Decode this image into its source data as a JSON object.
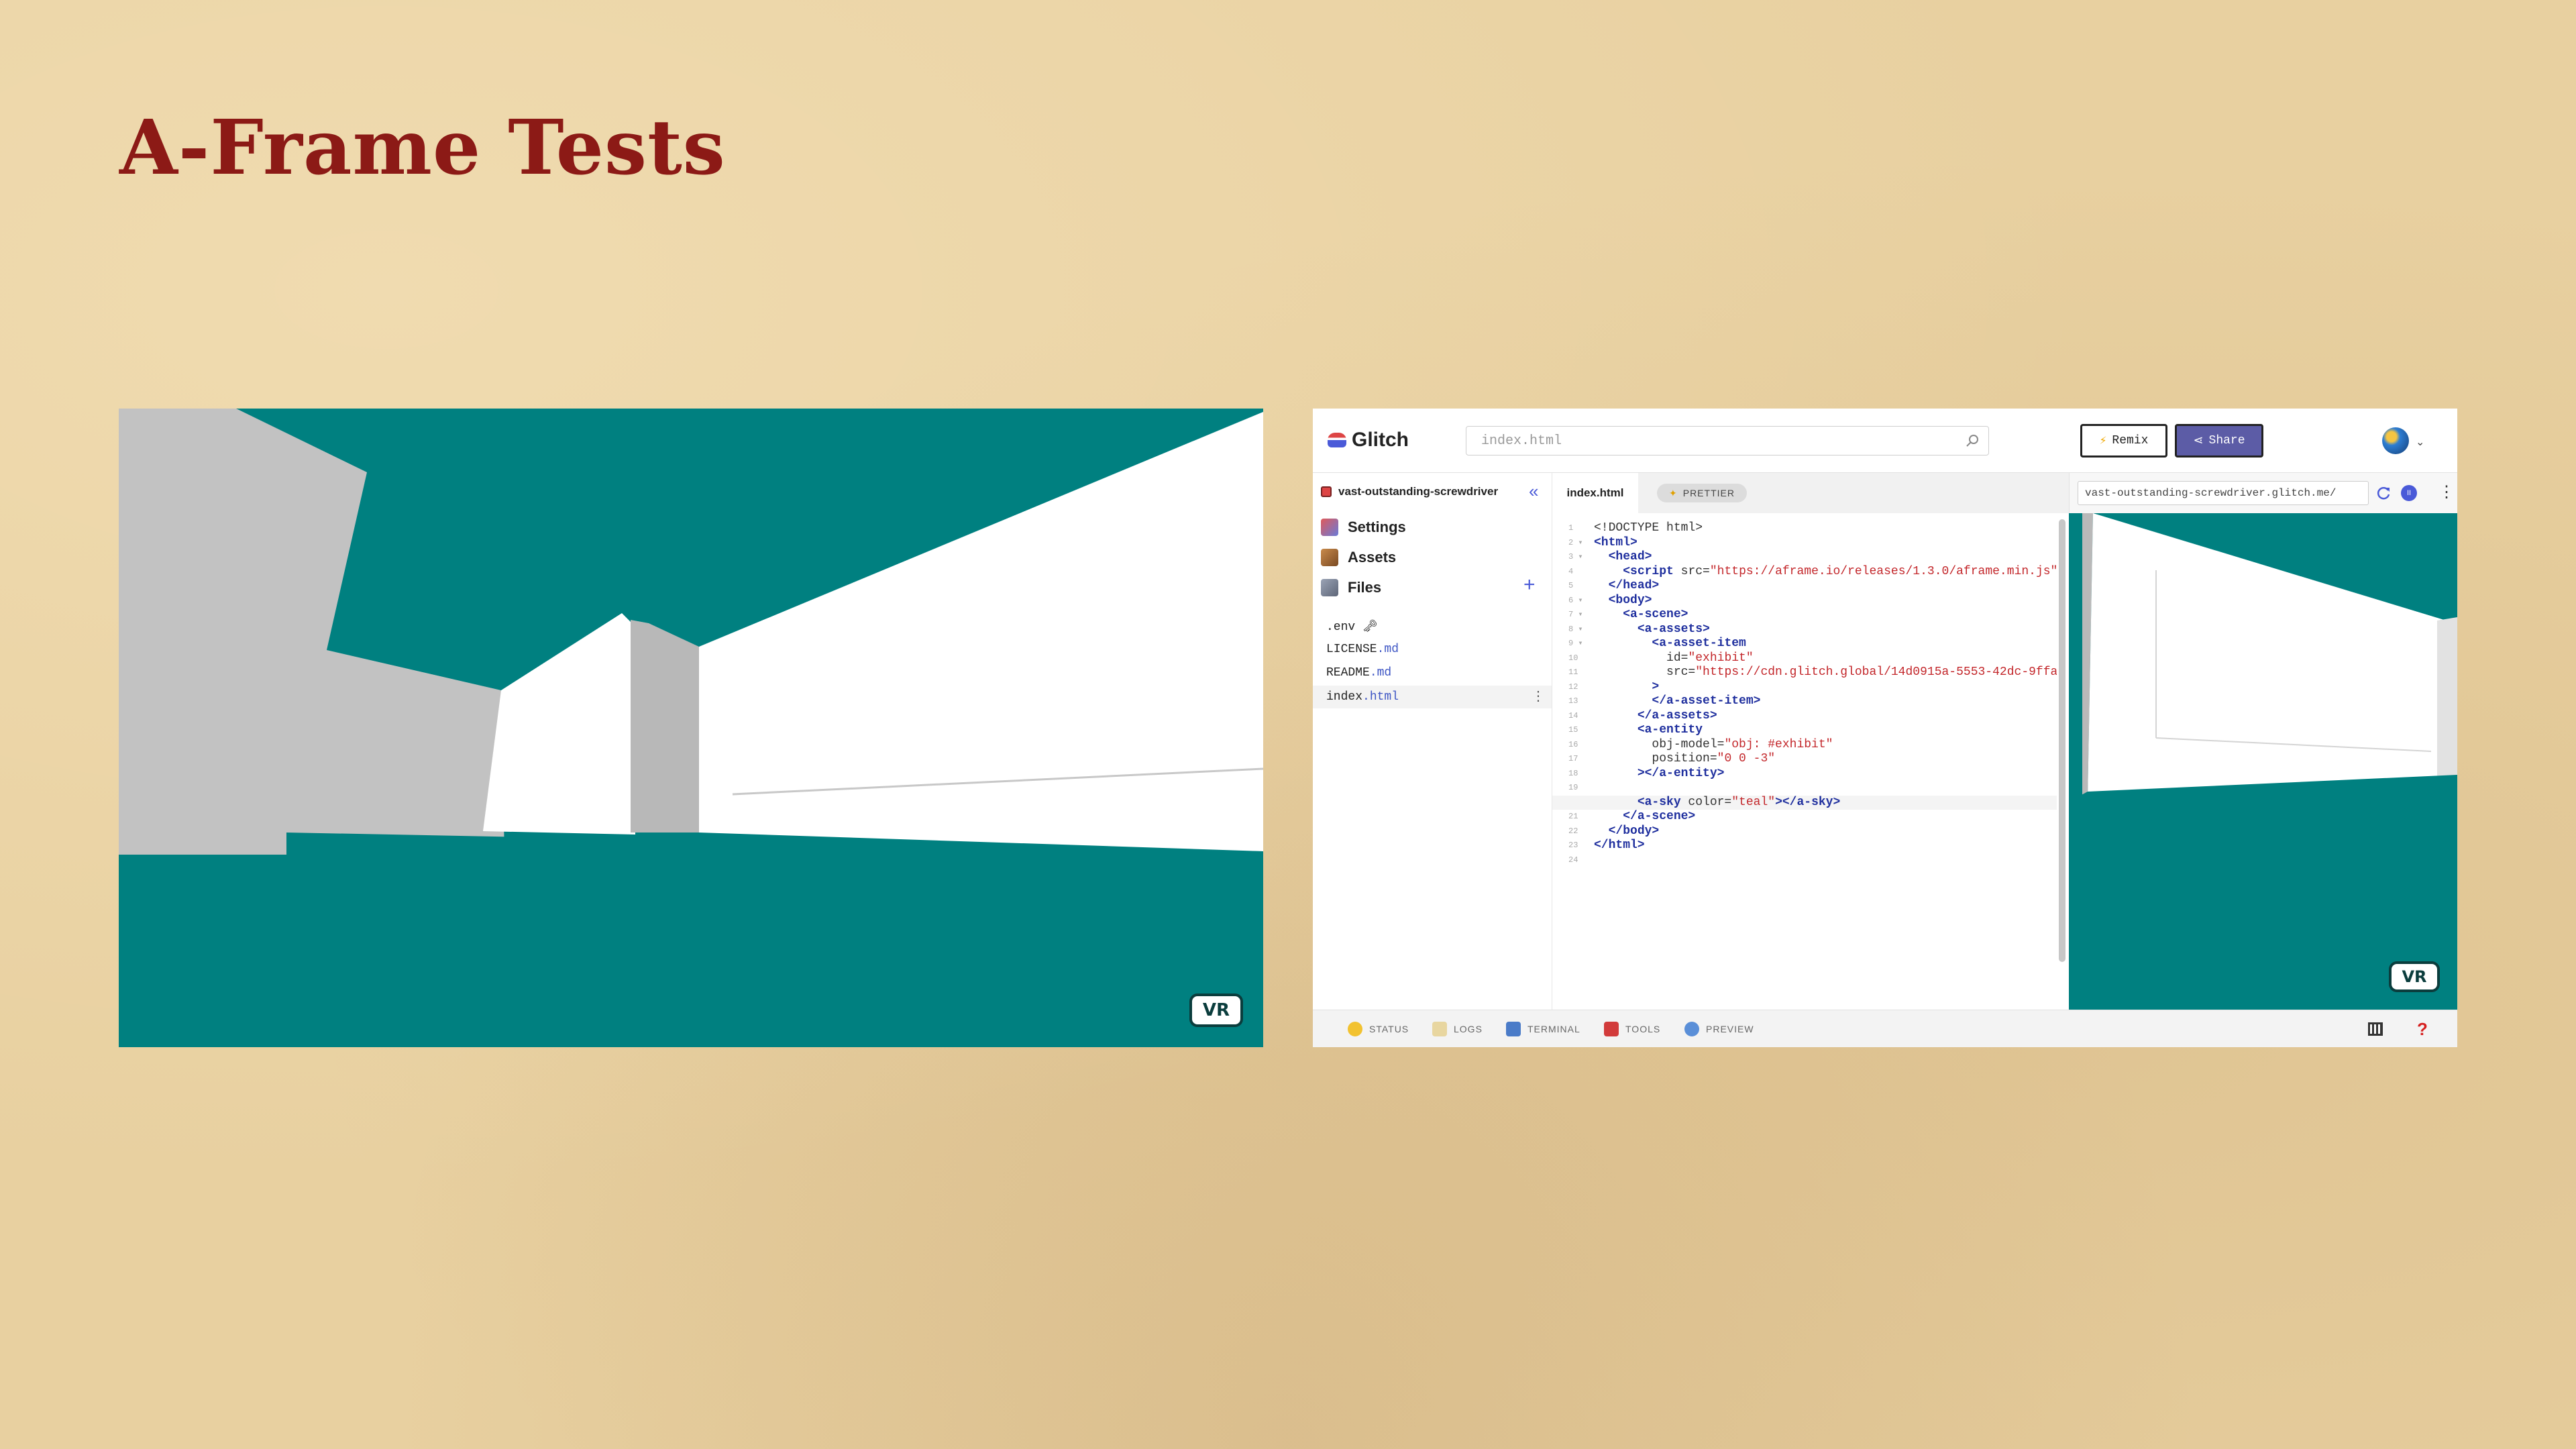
{
  "slide": {
    "title": "A-Frame Tests"
  },
  "left_scene": {
    "vr_label": "VR"
  },
  "glitch": {
    "logo_text": "Glitch",
    "search_placeholder": "index.html",
    "remix_label": "Remix",
    "share_label": "Share",
    "project_name": "vast-outstanding-screwdriver",
    "nav": {
      "settings": "Settings",
      "assets": "Assets",
      "files": "Files"
    },
    "files": [
      {
        "name": ".env",
        "ext": "",
        "suffix": "🗝"
      },
      {
        "name": "LICENSE",
        "ext": ".md",
        "suffix": ""
      },
      {
        "name": "README",
        "ext": ".md",
        "suffix": ""
      },
      {
        "name": "index",
        "ext": ".html",
        "suffix": ""
      }
    ],
    "active_tab": "index.html",
    "prettier_label": "PRETTIER",
    "preview_url": "vast-outstanding-screwdriver.glitch.me/",
    "preview_vr_label": "VR",
    "footer": {
      "status": "STATUS",
      "logs": "LOGS",
      "terminal": "TERMINAL",
      "tools": "TOOLS",
      "preview": "PREVIEW"
    },
    "code_lines": [
      [
        [
          "d",
          "<!DOCTYPE html>"
        ]
      ],
      [
        [
          "t",
          "<html>"
        ]
      ],
      [
        [
          "d",
          "  "
        ],
        [
          "t",
          "<head>"
        ]
      ],
      [
        [
          "d",
          "    "
        ],
        [
          "t",
          "<script"
        ],
        [
          "d",
          " src="
        ],
        [
          "s",
          "\"https://aframe.io/releases/1.3.0/aframe.min.js\""
        ],
        [
          "t",
          ">"
        ]
      ],
      [
        [
          "d",
          "  "
        ],
        [
          "t",
          "</head>"
        ]
      ],
      [
        [
          "d",
          "  "
        ],
        [
          "t",
          "<body>"
        ]
      ],
      [
        [
          "d",
          "    "
        ],
        [
          "t",
          "<a-scene>"
        ]
      ],
      [
        [
          "d",
          "      "
        ],
        [
          "t",
          "<a-assets>"
        ]
      ],
      [
        [
          "d",
          "        "
        ],
        [
          "t",
          "<a-asset-item"
        ]
      ],
      [
        [
          "d",
          "          id="
        ],
        [
          "s",
          "\"exhibit\""
        ]
      ],
      [
        [
          "d",
          "          src="
        ],
        [
          "s",
          "\"https://cdn.glitch.global/14d0915a-5553-42dc-9ffa"
        ]
      ],
      [
        [
          "d",
          "        "
        ],
        [
          "t",
          ">"
        ]
      ],
      [
        [
          "d",
          "        "
        ],
        [
          "t",
          "</a-asset-item>"
        ]
      ],
      [
        [
          "d",
          "      "
        ],
        [
          "t",
          "</a-assets>"
        ]
      ],
      [
        [
          "d",
          "      "
        ],
        [
          "t",
          "<a-entity"
        ]
      ],
      [
        [
          "d",
          "        obj-model="
        ],
        [
          "s",
          "\"obj: #exhibit\""
        ]
      ],
      [
        [
          "d",
          "        position="
        ],
        [
          "s",
          "\"0 0 -3\""
        ]
      ],
      [
        [
          "d",
          "      "
        ],
        [
          "t",
          "></a-entity>"
        ]
      ],
      [
        [
          "d",
          ""
        ]
      ],
      [
        [
          "d",
          "      "
        ],
        [
          "t",
          "<a-sky"
        ],
        [
          "d",
          " color="
        ],
        [
          "s",
          "\"teal\""
        ],
        [
          "t",
          "></a-sky>"
        ]
      ],
      [
        [
          "d",
          "    "
        ],
        [
          "t",
          "</a-scene>"
        ]
      ],
      [
        [
          "d",
          "  "
        ],
        [
          "t",
          "</body>"
        ]
      ],
      [
        [
          "t",
          "</html>"
        ]
      ],
      [
        [
          "d",
          ""
        ]
      ]
    ],
    "line_numbers": [
      "1",
      "2 ▾",
      "3 ▾",
      "4",
      "5",
      "6 ▾",
      "7 ▾",
      "8 ▾",
      "9 ▾",
      "10",
      "11",
      "12",
      "13",
      "14",
      "15",
      "16",
      "17",
      "18",
      "19",
      "20",
      "21",
      "22",
      "23",
      "24"
    ],
    "highlighted_line": 20
  },
  "colors": {
    "title": "#8c1a16",
    "sky": "#008080",
    "glitch_accent": "#4a5ad8",
    "share_bg": "#5c5ca6"
  }
}
